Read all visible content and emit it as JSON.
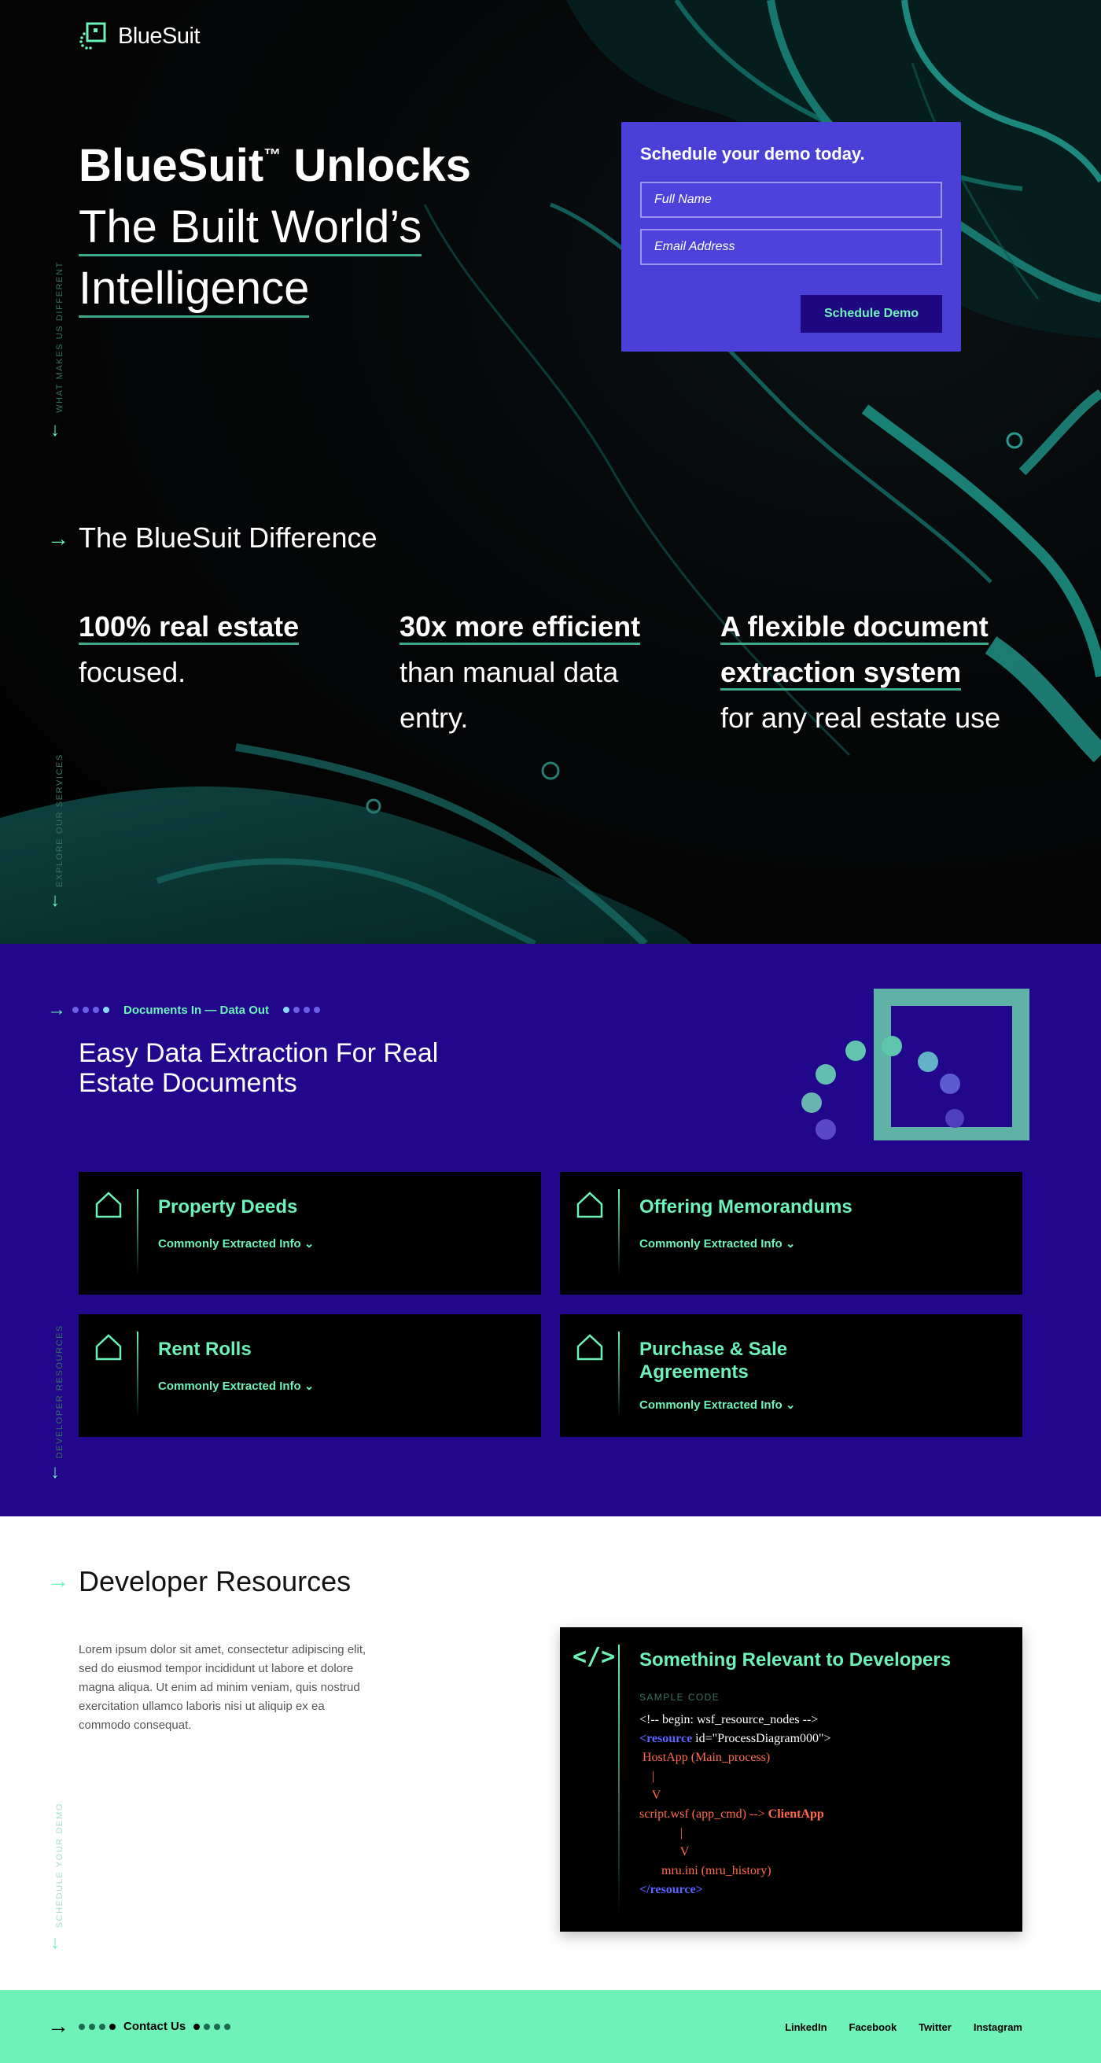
{
  "brand": {
    "name": "BlueSuit"
  },
  "hero": {
    "title_bold": "BlueSuit",
    "title_tm": "™",
    "title_bold2": " Unlocks",
    "title_line2": "The Built World’s",
    "title_line3": "Intelligence"
  },
  "demo": {
    "heading": "Schedule your demo today.",
    "name_placeholder": "Full Name",
    "email_placeholder": "Email Address",
    "button": "Schedule Demo"
  },
  "side_labels": {
    "what": "WHAT MAKES US DIFFERENT",
    "explore": "EXPLORE OUR SERVICES",
    "developer": "DEVELOPER RESOURCES",
    "schedule": "SCHEDULE YOUR DEMO"
  },
  "difference": {
    "title": "The BlueSuit Difference",
    "stats": [
      {
        "bold": "100% real estate",
        "rest": "focused."
      },
      {
        "bold": "30x more efficient",
        "rest1": "than manual data",
        "rest2": "entry."
      },
      {
        "bold1": "A flexible document",
        "bold2": "extraction system",
        "rest": "for any real estate use"
      }
    ]
  },
  "services": {
    "crumb": "Documents In — Data Out",
    "title": "Easy Data Extraction For Real Estate Documents",
    "cards": [
      {
        "title": "Property Deeds",
        "more": "Commonly Extracted Info ⌄"
      },
      {
        "title": "Offering Memorandums",
        "more": "Commonly Extracted Info ⌄"
      },
      {
        "title": "Rent Rolls",
        "more": "Commonly Extracted Info ⌄"
      },
      {
        "title": "Purchase & Sale Agreements",
        "more": "Commonly Extracted Info ⌄"
      }
    ]
  },
  "developer": {
    "title": "Developer Resources",
    "body": "Lorem ipsum dolor sit amet, consectetur adipiscing elit, sed do eiusmod tempor incididunt ut labore et dolore magna aliqua. Ut enim ad minim veniam, quis nostrud exercitation ullamco laboris nisi ut aliquip ex ea commodo consequat.",
    "card_title": "Something Relevant to Developers",
    "code_label": "SAMPLE CODE",
    "code": {
      "l1": "<!-- begin: wsf_resource_nodes -->",
      "l2a": "<resource",
      "l2b": " id=\"ProcessDiagram000\">",
      "l3": " HostApp (Main_process)",
      "l4": "    |",
      "l5": "    V",
      "l6a": "script.wsf (app_cmd) --> ",
      "l6b": "ClientApp",
      "l7": "             |",
      "l8": "             V",
      "l9": "       mru.ini (mru_history)",
      "l10": "</resource>"
    }
  },
  "footer": {
    "contact": "Contact Us",
    "links": [
      "LinkedIn",
      "Facebook",
      "Twitter",
      "Instagram"
    ]
  },
  "colors": {
    "accent_green": "#6ef2b8",
    "indigo": "#22068c",
    "card_blue": "#4a3fd6"
  }
}
